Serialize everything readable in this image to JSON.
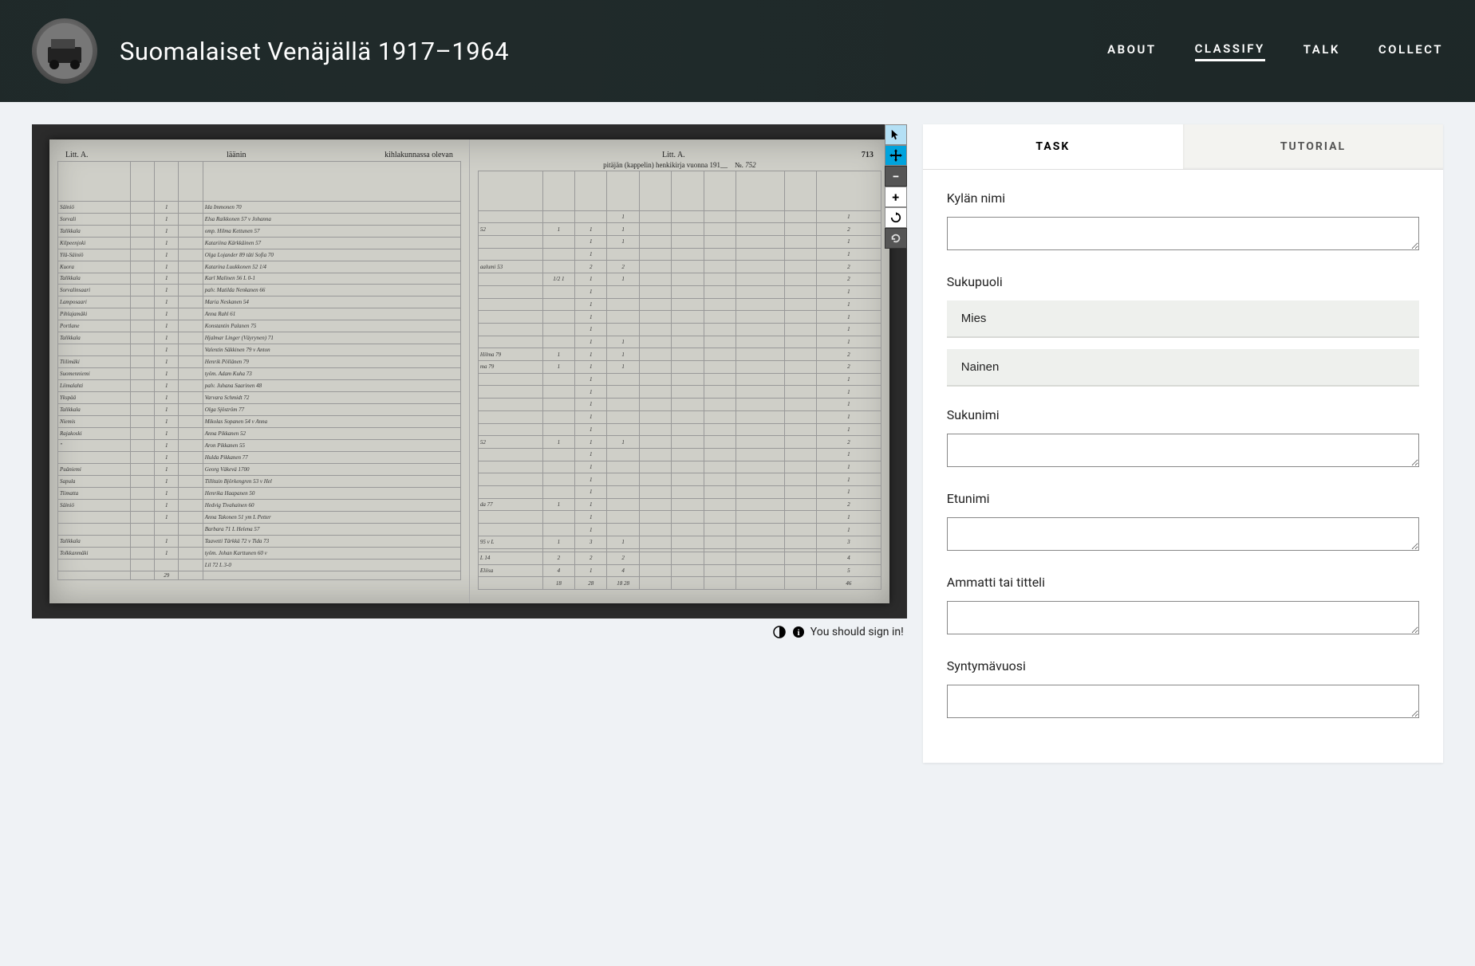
{
  "header": {
    "title": "Suomalaiset Venäjällä 1917–1964",
    "nav": {
      "about": "ABOUT",
      "classify": "CLASSIFY",
      "talk": "TALK",
      "collect": "COLLECT"
    }
  },
  "viewer": {
    "signin_prompt": "You should sign in!",
    "doc": {
      "litt_left": "Litt. A.",
      "litt_right": "Litt. A.",
      "page_no": "713",
      "sheet_no": "752",
      "left_head_center": "läänin",
      "left_head_right": "kihlakunnassa olevan",
      "right_head": "pitäjän (kappelin) henkikirja vuonna 191",
      "rows_left": [
        {
          "v": "Säiniö",
          "n": "1",
          "name": "Ida Immonen 70"
        },
        {
          "v": "Sorvali",
          "n": "1",
          "name": "Elsa Raikkonen 57 v Johanna"
        },
        {
          "v": "Talikkala",
          "n": "1",
          "name": "omp. Hilma Kettunen 57"
        },
        {
          "v": "Kilpeenjoki",
          "n": "1",
          "name": "Katariina Kärkkäinen 57"
        },
        {
          "v": "Ylä-Säiniö",
          "n": "1",
          "name": "Olga Lojander 89 täti Sofia 70"
        },
        {
          "v": "Kuora",
          "n": "1",
          "name": "Katarina Luukkonen 52 1/4"
        },
        {
          "v": "Talikkala",
          "n": "1",
          "name": "Karl Malinen 56 L 0-1"
        },
        {
          "v": "Sorvalinsaari",
          "n": "1",
          "name": "palv. Matilda Nenkanen 66"
        },
        {
          "v": "Lamposaari",
          "n": "1",
          "name": "Maria Neskanen 54"
        },
        {
          "v": "Pihlajamäki",
          "n": "1",
          "name": "Anna Rahl 61"
        },
        {
          "v": "Portlane",
          "n": "1",
          "name": "Konstantin Palanen 75"
        },
        {
          "v": "Talikkala",
          "n": "1",
          "name": "Hjalmar Linger (Väyrynen) 71"
        },
        {
          "v": "",
          "n": "1",
          "name": "Valentin Säkkinen 79 v Anton"
        },
        {
          "v": "Tiilimäki",
          "n": "1",
          "name": "Henrik Pöllänen 79"
        },
        {
          "v": "Suomenniemi",
          "n": "1",
          "name": "työm. Adam Kuha 73"
        },
        {
          "v": "Liimalahti",
          "n": "1",
          "name": "palv. Juhana Saarinen 48"
        },
        {
          "v": "Ykspää",
          "n": "1",
          "name": "Varvara Schmidt 72"
        },
        {
          "v": "Talikkala",
          "n": "1",
          "name": "Olga Sjöström 77"
        },
        {
          "v": "Niemis",
          "n": "1",
          "name": "Mikolas Sopanen 54 v Anna"
        },
        {
          "v": "Rajakoski",
          "n": "1",
          "name": "Anna Pikkanen 52"
        },
        {
          "v": "\"",
          "n": "1",
          "name": "Aron Pikkanen 55"
        },
        {
          "v": "",
          "n": "1",
          "name": "Hulda Pikkanen 77"
        },
        {
          "v": "Puäniemi",
          "n": "1",
          "name": "Georg Väkevä 1700"
        },
        {
          "v": "Sapula",
          "n": "1",
          "name": "Tillitain Björkengren 53 v Hel"
        },
        {
          "v": "Tiimatta",
          "n": "1",
          "name": "Henrika Haapanen 50"
        },
        {
          "v": "Säiniö",
          "n": "1",
          "name": "Hedvig Tivahainen 60"
        },
        {
          "v": "",
          "n": "1",
          "name": "Anna Takonen 51 ym L Petter"
        },
        {
          "v": "",
          "n": "",
          "name": "Barbara 71 L Helena 57"
        },
        {
          "v": "Talikkala",
          "n": "1",
          "name": "Taavetti Tärkkä 72 v Tida 73"
        },
        {
          "v": "Tolkkanmäki",
          "n": "1",
          "name": "työm. Johan Karttunen 60 v"
        },
        {
          "v": "",
          "n": "",
          "name": "Lil 72 L 3-0"
        }
      ],
      "rows_right": [
        {
          "a": "",
          "b": "",
          "c": "",
          "d": "1",
          "e": "1"
        },
        {
          "a": "52",
          "b": "1",
          "c": "1",
          "d": "1",
          "e": "2"
        },
        {
          "a": "",
          "b": "",
          "c": "1",
          "d": "1",
          "e": "1"
        },
        {
          "a": "",
          "b": "",
          "c": "1",
          "d": "",
          "e": "1"
        },
        {
          "a": "aalumi 53",
          "b": "",
          "c": "2",
          "d": "2",
          "e": "2"
        },
        {
          "a": "",
          "b": "1/2 1",
          "c": "1",
          "d": "1",
          "e": "2"
        },
        {
          "a": "",
          "b": "",
          "c": "1",
          "d": "",
          "e": "1"
        },
        {
          "a": "",
          "b": "",
          "c": "1",
          "d": "",
          "e": "1"
        },
        {
          "a": "",
          "b": "",
          "c": "1",
          "d": "",
          "e": "1"
        },
        {
          "a": "",
          "b": "",
          "c": "1",
          "d": "",
          "e": "1"
        },
        {
          "a": "",
          "b": "",
          "c": "1",
          "d": "1",
          "e": "1"
        },
        {
          "a": "Hilma 79",
          "b": "1",
          "c": "1",
          "d": "1",
          "e": "2"
        },
        {
          "a": "ma 79",
          "b": "1",
          "c": "1",
          "d": "1",
          "e": "2"
        },
        {
          "a": "",
          "b": "",
          "c": "1",
          "d": "",
          "e": "1"
        },
        {
          "a": "",
          "b": "",
          "c": "1",
          "d": "",
          "e": "1"
        },
        {
          "a": "",
          "b": "",
          "c": "1",
          "d": "",
          "e": "1"
        },
        {
          "a": "",
          "b": "",
          "c": "1",
          "d": "",
          "e": "1"
        },
        {
          "a": "",
          "b": "",
          "c": "1",
          "d": "",
          "e": "1"
        },
        {
          "a": "52",
          "b": "1",
          "c": "1",
          "d": "1",
          "e": "2"
        },
        {
          "a": "",
          "b": "",
          "c": "1",
          "d": "",
          "e": "1"
        },
        {
          "a": "",
          "b": "",
          "c": "1",
          "d": "",
          "e": "1"
        },
        {
          "a": "",
          "b": "",
          "c": "1",
          "d": "",
          "e": "1"
        },
        {
          "a": "",
          "b": "",
          "c": "1",
          "d": "",
          "e": "1"
        },
        {
          "a": "da 77",
          "b": "1",
          "c": "1",
          "d": "",
          "e": "2"
        },
        {
          "a": "",
          "b": "",
          "c": "1",
          "d": "",
          "e": "1"
        },
        {
          "a": "",
          "b": "",
          "c": "1",
          "d": "",
          "e": "1"
        },
        {
          "a": "95 v L",
          "b": "1",
          "c": "3",
          "d": "1",
          "e": "3"
        },
        {
          "a": "",
          "b": "",
          "c": "",
          "d": "",
          "e": ""
        },
        {
          "a": "L 14",
          "b": "2",
          "c": "2",
          "d": "2",
          "e": "4"
        },
        {
          "a": "Eliisa",
          "b": "4",
          "c": "1",
          "d": "4",
          "e": "5"
        },
        {
          "a": "",
          "b": "18",
          "c": "28",
          "d": "18 28",
          "e": "46"
        }
      ],
      "total_left": "29"
    }
  },
  "panel": {
    "tabs": {
      "task": "TASK",
      "tutorial": "TUTORIAL"
    },
    "fields": {
      "village_label": "Kylän nimi",
      "gender_label": "Sukupuoli",
      "gender_options": {
        "male": "Mies",
        "female": "Nainen"
      },
      "surname_label": "Sukunimi",
      "firstname_label": "Etunimi",
      "occupation_label": "Ammatti tai titteli",
      "birthyear_label": "Syntymävuosi"
    }
  }
}
